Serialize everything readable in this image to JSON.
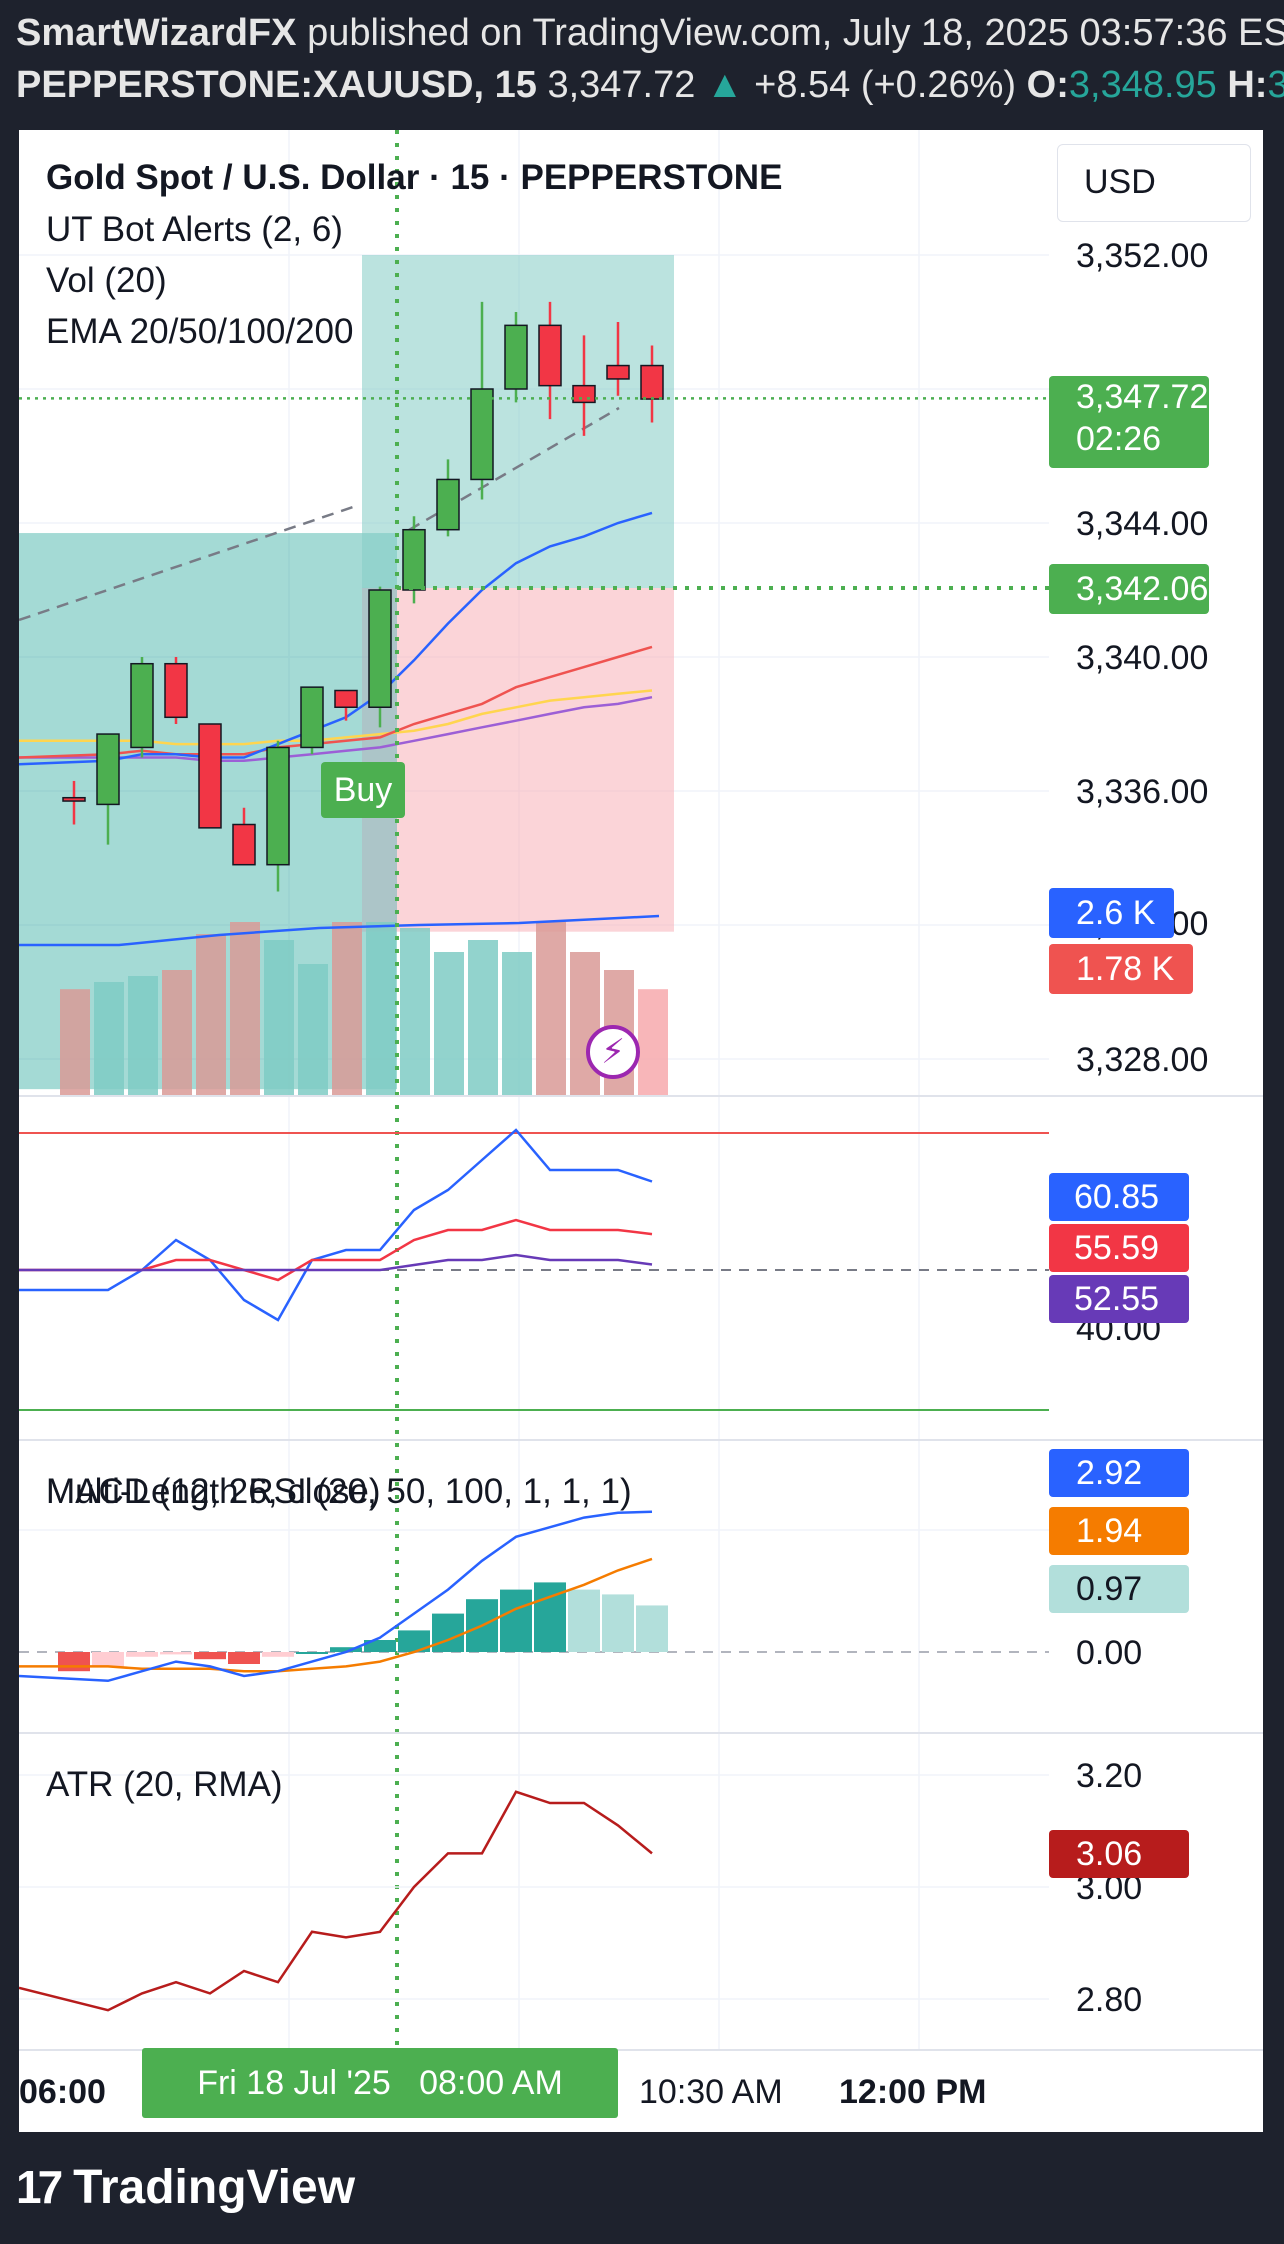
{
  "header": {
    "author": "SmartWizardFX",
    "published": "published on TradingView.com, July 18, 2025 03:57:36 EST",
    "symbol": "PEPPERSTONE:XAUUSD, 15",
    "price": "3,347.72",
    "change": "+8.54 (+0.26%)",
    "open_label": "O:",
    "open": "3,348.95",
    "high_label": "H:",
    "high": "3,3"
  },
  "legend": {
    "title": "Gold Spot / U.S. Dollar · 15 · PEPPERSTONE",
    "ind1": "UT Bot Alerts (2, 6)",
    "ind2": "Vol (20)",
    "ind3": "EMA 20/50/100/200"
  },
  "currency_button": "USD",
  "buy_label": "Buy",
  "time_label": "Fri 18 Jul '25   08:00 AM",
  "brand": "TradingView",
  "colors": {
    "up": "#26a69a",
    "down": "#ef5350",
    "candle_up": "#4caf50",
    "candle_down": "#f23645",
    "ema20": "#2962ff",
    "ema50": "#ef5350",
    "ema100": "#ffd54f",
    "ema200": "#9c5fd6",
    "macd": "#2962ff",
    "signal": "#f57c00",
    "atr": "#b71c1c",
    "highlight": "#4caf50"
  },
  "chart_data": [
    {
      "type": "candlestick",
      "title": "Gold Spot / U.S. Dollar · 15 · PEPPERSTONE",
      "ylim": [
        3326,
        3353
      ],
      "y_ticks": [
        "3,352.00",
        "3,344.00",
        "3,340.00",
        "3,336.00",
        "3,328.00"
      ],
      "x_ticks": [
        "06:00",
        "10:30 AM",
        "12:00 PM"
      ],
      "x_highlight": "Fri 18 Jul '25   08:00 AM",
      "current_price": "3,347.72",
      "countdown": "02:26",
      "entry_price": "3,342.06",
      "candles": [
        {
          "o": 3335.8,
          "h": 3336.3,
          "l": 3335.0,
          "c": 3335.7
        },
        {
          "o": 3335.6,
          "h": 3337.3,
          "l": 3334.4,
          "c": 3337.7
        },
        {
          "o": 3337.3,
          "h": 3340.0,
          "l": 3337.0,
          "c": 3339.8
        },
        {
          "o": 3339.8,
          "h": 3340.0,
          "l": 3338.0,
          "c": 3338.2
        },
        {
          "o": 3338.0,
          "h": 3338.0,
          "l": 3334.9,
          "c": 3334.9
        },
        {
          "o": 3335.0,
          "h": 3335.5,
          "l": 3333.8,
          "c": 3333.8
        },
        {
          "o": 3333.8,
          "h": 3337.5,
          "l": 3333.0,
          "c": 3337.3
        },
        {
          "o": 3337.3,
          "h": 3338.9,
          "l": 3337.1,
          "c": 3339.1
        },
        {
          "o": 3339.0,
          "h": 3339.0,
          "l": 3338.1,
          "c": 3338.5
        },
        {
          "o": 3338.5,
          "h": 3342.1,
          "l": 3337.9,
          "c": 3342.0
        },
        {
          "o": 3342.0,
          "h": 3344.2,
          "l": 3341.6,
          "c": 3343.8
        },
        {
          "o": 3343.8,
          "h": 3345.9,
          "l": 3343.6,
          "c": 3345.3
        },
        {
          "o": 3345.3,
          "h": 3350.6,
          "l": 3344.7,
          "c": 3348.0
        },
        {
          "o": 3348.0,
          "h": 3350.3,
          "l": 3347.6,
          "c": 3349.9
        },
        {
          "o": 3349.9,
          "h": 3350.6,
          "l": 3347.1,
          "c": 3348.1
        },
        {
          "o": 3348.1,
          "h": 3349.6,
          "l": 3346.6,
          "c": 3347.6
        },
        {
          "o": 3348.7,
          "h": 3350.0,
          "l": 3347.8,
          "c": 3348.3
        },
        {
          "o": 3348.7,
          "h": 3349.3,
          "l": 3347.0,
          "c": 3347.7
        }
      ],
      "ema20": [
        3336.8,
        3336.9,
        3337.1,
        3337.1,
        3337.0,
        3337.0,
        3337.4,
        3337.8,
        3338.2,
        3338.9,
        3339.9,
        3341.0,
        3342.0,
        3342.8,
        3343.3,
        3343.6,
        3344.0,
        3344.3
      ],
      "ema50": [
        3337.0,
        3337.1,
        3337.2,
        3337.1,
        3337.1,
        3337.1,
        3337.3,
        3337.4,
        3337.5,
        3337.6,
        3338.0,
        3338.3,
        3338.6,
        3339.1,
        3339.4,
        3339.7,
        3340.0,
        3340.3
      ],
      "ema100": [
        3337.5,
        3337.5,
        3337.5,
        3337.4,
        3337.4,
        3337.4,
        3337.5,
        3337.5,
        3337.6,
        3337.7,
        3337.8,
        3338.0,
        3338.3,
        3338.5,
        3338.7,
        3338.8,
        3338.9,
        3339.0
      ],
      "ema200": [
        3337.0,
        3337.0,
        3337.0,
        3337.0,
        3336.9,
        3336.9,
        3337.0,
        3337.1,
        3337.2,
        3337.3,
        3337.5,
        3337.7,
        3337.9,
        3338.1,
        3338.3,
        3338.5,
        3338.6,
        3338.8
      ],
      "volume": [
        1780,
        1900,
        2000,
        2100,
        2700,
        2900,
        2600,
        2200,
        2900,
        2900,
        2800,
        2400,
        2600,
        2400,
        2900,
        2400,
        2100,
        1780
      ],
      "volume_labels": [
        "2.6 K",
        "1.78 K"
      ],
      "trade_box": {
        "entry": 3342.06,
        "target": 3352.0,
        "stop": 3331.8
      }
    },
    {
      "type": "line",
      "title": "Multi-Length RSI (20, 50, 100, 1, 1, 1)",
      "y_ticks": [
        "40.00"
      ],
      "current_values": [
        "60.85",
        "55.59",
        "52.55"
      ],
      "series": [
        {
          "values": [
            50,
            50,
            52,
            55,
            53,
            49,
            47,
            53,
            54,
            54,
            58,
            60,
            63,
            66,
            62,
            62,
            62,
            60.85
          ]
        },
        {
          "values": [
            52,
            52,
            52,
            53,
            53,
            52,
            51,
            53,
            53,
            53,
            55,
            56,
            56,
            57,
            56,
            56,
            56,
            55.59
          ]
        },
        {
          "values": [
            52,
            52,
            52,
            52,
            52,
            52,
            52,
            52,
            52,
            52,
            52.5,
            53,
            53,
            53.5,
            53,
            53,
            53,
            52.55
          ]
        }
      ]
    },
    {
      "type": "bar",
      "title": "MACD (12, 26, close)",
      "y_ticks": [
        "0.00"
      ],
      "current_values": [
        "2.92",
        "1.94",
        "0.97"
      ],
      "histogram": [
        -0.4,
        -0.3,
        -0.1,
        -0.05,
        -0.15,
        -0.25,
        -0.1,
        0.0,
        0.1,
        0.25,
        0.45,
        0.8,
        1.1,
        1.3,
        1.45,
        1.3,
        1.2,
        0.97
      ],
      "series": [
        {
          "name": "MACD",
          "values": [
            -0.5,
            -0.6,
            -0.4,
            -0.2,
            -0.3,
            -0.5,
            -0.4,
            -0.2,
            0.0,
            0.3,
            0.8,
            1.3,
            1.9,
            2.4,
            2.6,
            2.8,
            2.9,
            2.92
          ]
        },
        {
          "name": "Signal",
          "values": [
            -0.3,
            -0.3,
            -0.35,
            -0.35,
            -0.35,
            -0.4,
            -0.4,
            -0.35,
            -0.3,
            -0.2,
            0.0,
            0.25,
            0.55,
            0.9,
            1.15,
            1.4,
            1.7,
            1.94
          ]
        }
      ]
    },
    {
      "type": "line",
      "title": "ATR (20, RMA)",
      "y_ticks": [
        "3.20",
        "3.00",
        "2.80"
      ],
      "current_value": "3.06",
      "series": [
        {
          "values": [
            2.82,
            2.78,
            2.81,
            2.83,
            2.81,
            2.85,
            2.83,
            2.92,
            2.91,
            2.92,
            3.0,
            3.06,
            3.06,
            3.17,
            3.15,
            3.15,
            3.11,
            3.06
          ]
        }
      ]
    }
  ]
}
